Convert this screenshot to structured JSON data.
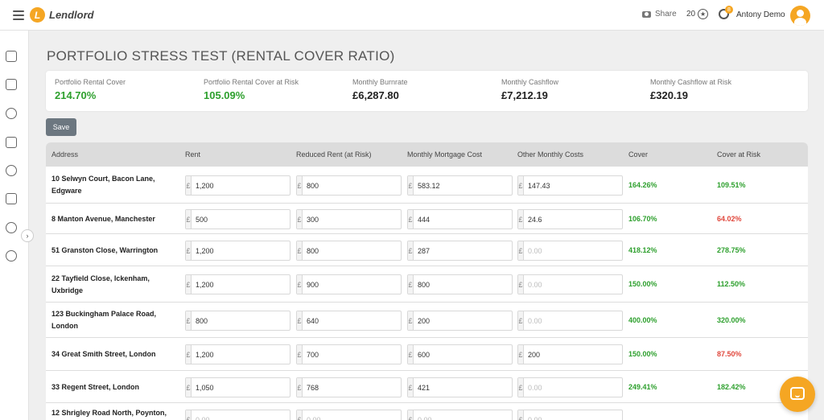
{
  "header": {
    "logo_mark": "L",
    "logo_text": "Lendlord",
    "share_label": "Share",
    "points": "20",
    "notification_count": "8",
    "user_name": "Antony Demo"
  },
  "page": {
    "title": "PORTFOLIO STRESS TEST (RENTAL COVER RATIO)"
  },
  "summary": [
    {
      "label": "Portfolio Rental Cover",
      "value": "214.70%"
    },
    {
      "label": "Portfolio Rental Cover at Risk",
      "value": "105.09%"
    },
    {
      "label": "Monthly Burnrate",
      "value": "£6,287.80"
    },
    {
      "label": "Monthly Cashflow",
      "value": "£7,212.19"
    },
    {
      "label": "Monthly Cashflow at Risk",
      "value": "£320.19"
    }
  ],
  "save_label": "Save",
  "table": {
    "headers": [
      "Address",
      "Rent",
      "Reduced Rent (at Risk)",
      "Monthly Mortgage Cost",
      "Other Monthly Costs",
      "Cover",
      "Cover at Risk"
    ],
    "currency": "£",
    "placeholder": "0.00",
    "rows": [
      {
        "address": "10 Selwyn Court, Bacon Lane, Edgware",
        "rent": "1,200",
        "reduced": "800",
        "mortgage": "583.12",
        "other": "147.43",
        "cover": "164.26%",
        "risk": "109.51%",
        "risk_status": "green"
      },
      {
        "address": "8 Manton Avenue, Manchester",
        "rent": "500",
        "reduced": "300",
        "mortgage": "444",
        "other": "24.6",
        "cover": "106.70%",
        "risk": "64.02%",
        "risk_status": "red"
      },
      {
        "address": "51 Granston Close, Warrington",
        "rent": "1,200",
        "reduced": "800",
        "mortgage": "287",
        "other": "",
        "cover": "418.12%",
        "risk": "278.75%",
        "risk_status": "green"
      },
      {
        "address": "22 Tayfield Close, Ickenham, Uxbridge",
        "rent": "1,200",
        "reduced": "900",
        "mortgage": "800",
        "other": "",
        "cover": "150.00%",
        "risk": "112.50%",
        "risk_status": "green"
      },
      {
        "address": "123 Buckingham Palace Road, London",
        "rent": "800",
        "reduced": "640",
        "mortgage": "200",
        "other": "",
        "cover": "400.00%",
        "risk": "320.00%",
        "risk_status": "green"
      },
      {
        "address": "34 Great Smith Street, London",
        "rent": "1,200",
        "reduced": "700",
        "mortgage": "600",
        "other": "200",
        "cover": "150.00%",
        "risk": "87.50%",
        "risk_status": "red"
      },
      {
        "address": "33 Regent Street, London",
        "rent": "1,050",
        "reduced": "768",
        "mortgage": "421",
        "other": "",
        "cover": "249.41%",
        "risk": "182.42%",
        "risk_status": "green"
      },
      {
        "address": "12 Shrigley Road North, Poynton,",
        "rent": "",
        "reduced": "",
        "mortgage": "",
        "other": "",
        "cover": "",
        "risk": "",
        "risk_status": "green"
      }
    ]
  },
  "colors": {
    "accent": "#f5a623",
    "positive": "#2ea02e",
    "negative": "#e0473c"
  }
}
